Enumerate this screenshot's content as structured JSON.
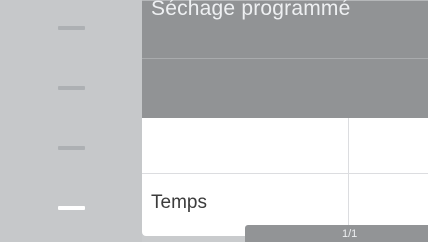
{
  "header": {
    "title": "Séchage programmé"
  },
  "rows": [
    {
      "label": ""
    },
    {
      "label": "Temps"
    }
  ],
  "pager": {
    "text": "1/1"
  },
  "sidebar": {
    "item_count": 4,
    "active_index": 3
  }
}
